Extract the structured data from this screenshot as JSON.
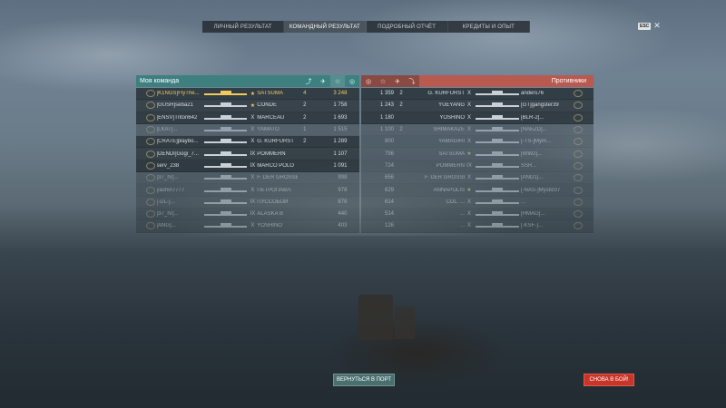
{
  "tabs": [
    {
      "label": "ЛИЧНЫЙ РЕЗУЛЬТАТ"
    },
    {
      "label": "КОМАНДНЫЙ РЕЗУЛЬТАТ"
    },
    {
      "label": "ПОДРОБНЫЙ ОТЧЁТ"
    },
    {
      "label": "КРЕДИТЫ И ОПЫТ"
    }
  ],
  "esc_label": "ESC",
  "left": {
    "title": "Моя команда",
    "rows": [
      {
        "name": "[K1NGS]FlyThe...",
        "tier": "★",
        "ship": "SATSUMA",
        "n1": "4",
        "n2": "",
        "score": "3 248",
        "me": true,
        "dead": false
      },
      {
        "name": "[GUSH]seba21",
        "tier": "★",
        "ship": "CONDÉ",
        "n1": "2",
        "n2": "",
        "score": "1 758",
        "me": false,
        "dead": false
      },
      {
        "name": "[ENSV]Triton642",
        "tier": "X",
        "ship": "MARCEAU",
        "n1": "2",
        "n2": "",
        "score": "1 693",
        "me": false,
        "dead": false
      },
      {
        "name": "[LKAT]...",
        "tier": "X",
        "ship": "YAMATO",
        "n1": "1",
        "n2": "",
        "score": "1 515",
        "me": false,
        "dead": true
      },
      {
        "name": "[CRATE]playbo...",
        "tier": "X",
        "ship": "G. KURFÜRST",
        "n1": "2",
        "n2": "",
        "score": "1 289",
        "me": false,
        "dead": false
      },
      {
        "name": "[DENDI]Gogi_7...",
        "tier": "IX",
        "ship": "POMMERN",
        "n1": "",
        "n2": "",
        "score": "1 107",
        "me": false,
        "dead": false
      },
      {
        "name": "serv_238",
        "tier": "IX",
        "ship": "MARCO POLO",
        "n1": "",
        "n2": "",
        "score": "1 091",
        "me": false,
        "dead": false
      },
      {
        "name": "[37_IV]...",
        "tier": "X",
        "ship": "F. DER GROSSE",
        "n1": "",
        "n2": "",
        "score": "998",
        "me": false,
        "dead": true
      },
      {
        "name": "yashin7777",
        "tier": "X",
        "ship": "ПЕТРОПАВЛ.",
        "n1": "",
        "n2": "",
        "score": "978",
        "me": false,
        "dead": true
      },
      {
        "name": "[-DL-]...",
        "tier": "IX",
        "ship": "ПУССОБОИ",
        "n1": "",
        "n2": "",
        "score": "878",
        "me": false,
        "dead": true
      },
      {
        "name": "[37_IV]...",
        "tier": "IX",
        "ship": "ALASKA B",
        "n1": "",
        "n2": "",
        "score": "440",
        "me": false,
        "dead": true
      },
      {
        "name": "[ANG]...",
        "tier": "X",
        "ship": "YOSHINO",
        "n1": "",
        "n2": "",
        "score": "403",
        "me": false,
        "dead": true
      }
    ]
  },
  "right": {
    "title": "Противники",
    "rows": [
      {
        "score": "1 359",
        "n1": "2",
        "n2": "",
        "ship": "G. KURFÜRST",
        "tier": "X",
        "name": "anders76",
        "dead": false
      },
      {
        "score": "1 243",
        "n1": "2",
        "n2": "",
        "ship": "YUEYANG",
        "tier": "X",
        "name": "[GT]gangster39",
        "dead": false
      },
      {
        "score": "1 180",
        "n1": "",
        "n2": "",
        "ship": "YOSHINO",
        "tier": "X",
        "name": "[BLR-2]...",
        "dead": false
      },
      {
        "score": "1 100",
        "n1": "2",
        "n2": "",
        "ship": "SHIMAKAZE",
        "tier": "X",
        "name": "[NAEZD]...",
        "dead": true
      },
      {
        "score": "800",
        "n1": "",
        "n2": "",
        "ship": "YAMAGIRI",
        "tier": "X",
        "name": "[-TS-]Mym...",
        "dead": true
      },
      {
        "score": "796",
        "n1": "",
        "n2": "",
        "ship": "SATSUMA",
        "tier": "★",
        "name": "[WW2]...",
        "dead": true
      },
      {
        "score": "724",
        "n1": "",
        "n2": "",
        "ship": "POMMERN",
        "tier": "IX",
        "name": "SSR...",
        "dead": true
      },
      {
        "score": "656",
        "n1": "",
        "n2": "",
        "ship": "F. DER GROSSE",
        "tier": "X",
        "name": "[AND1]...",
        "dead": true
      },
      {
        "score": "629",
        "n1": "",
        "n2": "",
        "ship": "ANNAPOLIS",
        "tier": "★",
        "name": "[-NAS-]Mystic07",
        "dead": true
      },
      {
        "score": "614",
        "n1": "",
        "n2": "",
        "ship": "COL. ...",
        "tier": "X",
        "name": "...",
        "dead": true
      },
      {
        "score": "514",
        "n1": "",
        "n2": "",
        "ship": "...",
        "tier": "X",
        "name": "[HMAG]...",
        "dead": true
      },
      {
        "score": "126",
        "n1": "",
        "n2": "",
        "ship": "...",
        "tier": "X",
        "name": "[-KSF-]...",
        "dead": true
      }
    ]
  },
  "buttons": {
    "port": "ВЕРНУТЬСЯ В ПОРТ",
    "battle": "СНОВА В БОЙ!"
  }
}
